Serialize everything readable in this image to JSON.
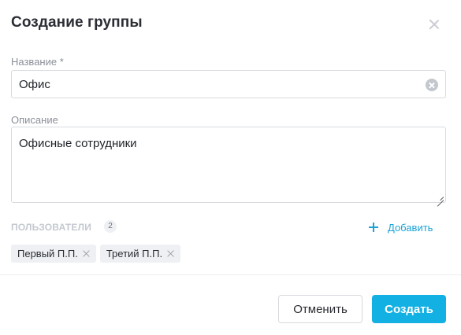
{
  "dialog": {
    "title": "Создание группы"
  },
  "name_field": {
    "label": "Название",
    "required_mark": "*",
    "value": "Офис"
  },
  "description_field": {
    "label": "Описание",
    "value": "Офисные сотрудники"
  },
  "users": {
    "heading": "ПОЛЬЗОВАТЕЛИ",
    "count": "2",
    "add_label": "Добавить",
    "items": [
      {
        "label": "Первый П.П."
      },
      {
        "label": "Третий П.П."
      }
    ]
  },
  "footer": {
    "cancel_label": "Отменить",
    "create_label": "Создать"
  },
  "colors": {
    "accent": "#12b0e3",
    "link": "#1aa3d6"
  },
  "icons": {
    "close": "close-icon",
    "clear": "clear-input-icon",
    "add": "plus-icon",
    "chip_remove": "close-icon",
    "resize": "resize-handle-icon"
  }
}
